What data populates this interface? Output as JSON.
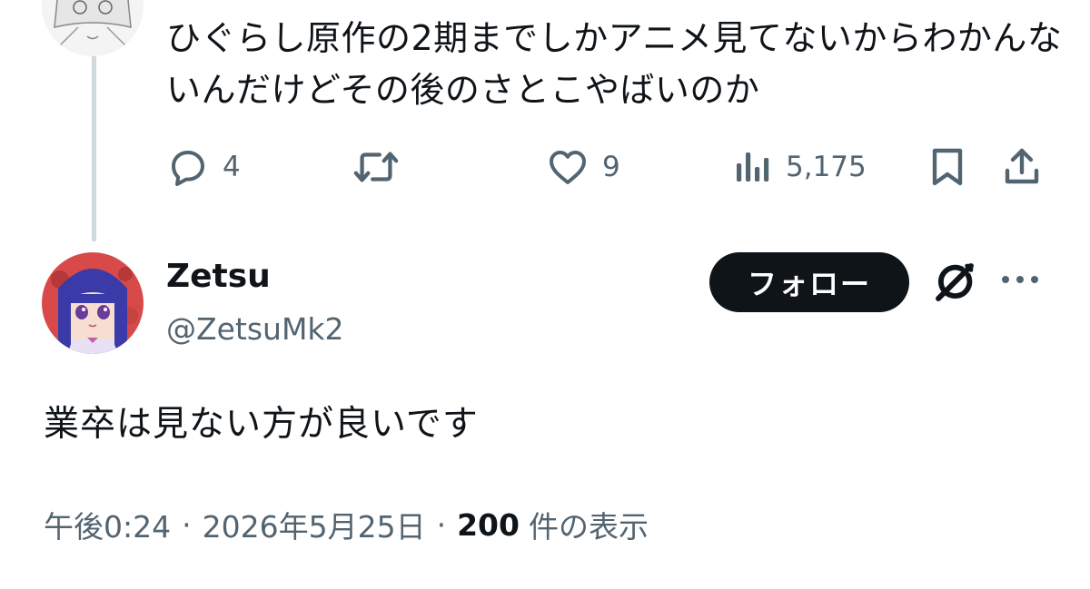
{
  "parent_tweet": {
    "text": "ひぐらし原作の2期までしかアニメ見てないからわかんないんだけどその後のさとこやばいのか",
    "actions": {
      "replies": "4",
      "retweets": "",
      "likes": "9",
      "views": "5,175"
    },
    "icons": {
      "reply": "reply-bubble-icon",
      "retweet": "retweet-icon",
      "like": "heart-icon",
      "views": "bar-chart-icon",
      "bookmark": "bookmark-icon",
      "share": "share-icon"
    }
  },
  "reply_tweet": {
    "author": {
      "name": "Zetsu",
      "handle": "@ZetsuMk2"
    },
    "follow_label": "フォロー",
    "text": "業卒は見ない方が良いです",
    "meta": {
      "time": "午後0:24",
      "date": "2026年5月25日",
      "separator": "·",
      "views_count": "200",
      "views_label": "件の表示"
    },
    "icons": {
      "grok": "grok-icon",
      "more": "more-options-icon"
    }
  },
  "colors": {
    "text_primary": "#0f1419",
    "text_secondary": "#536471",
    "thread_line": "#cfd9de",
    "button_bg": "#0f1419"
  }
}
